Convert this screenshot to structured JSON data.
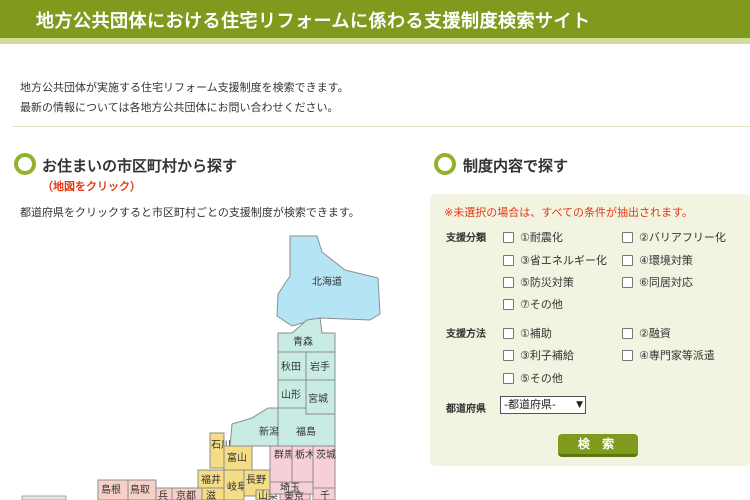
{
  "header": {
    "title": "地方公共団体における住宅リフォームに係わる支援制度検索サイト"
  },
  "intro": {
    "line1": "地方公共団体が実施する住宅リフォーム支援制度を検索できます。",
    "line2": "最新の情報については各地方公共団体にお問い合わせください。"
  },
  "map_section": {
    "title": "お住まいの市区町村から探す",
    "note": "（地図をクリック）",
    "description": "都道府県をクリックすると市区町村ごとの支援制度が検索できます。",
    "prefectures": {
      "hokkaido": "北海道",
      "aomori": "青森",
      "akita": "秋田",
      "iwate": "岩手",
      "yamagata": "山形",
      "miyagi": "宮城",
      "fukushima": "福島",
      "niigata": "新潟",
      "ishikawa": "石川",
      "toyama": "富山",
      "gunma": "群馬",
      "tochigi": "栃木",
      "ibaraki": "茨城",
      "fukui": "福井",
      "nagano": "長野",
      "saitama": "埼玉",
      "gifu": "岐阜",
      "shiga": "滋",
      "yamanashi": "山梨",
      "tokyo": "東京",
      "chiba": "千",
      "shimane": "島根",
      "tottori": "鳥取",
      "hyogo": "兵",
      "kyoto": "京都"
    }
  },
  "criteria_section": {
    "title": "制度内容で探す",
    "note": "※未選択の場合は、すべての条件が抽出されます。",
    "support_type": {
      "label": "支援分類",
      "options": [
        "①耐震化",
        "②バリアフリー化",
        "③省エネルギー化",
        "④環境対策",
        "⑤防災対策",
        "⑥同居対応",
        "⑦その他"
      ]
    },
    "support_method": {
      "label": "支援方法",
      "options": [
        "①補助",
        "②融資",
        "③利子補給",
        "④専門家等派遣",
        "⑤その他"
      ]
    },
    "prefecture": {
      "label": "都道府県",
      "selected": "-都道府県-"
    },
    "search_button": "検 索"
  },
  "colors": {
    "header": "#7f9a1c",
    "tohoku": "#c8ece3",
    "hokkaido": "#b5e4f5",
    "chubu": "#f5dd86",
    "kanto": "#f6cfd8",
    "chugoku": "#f6cfc6",
    "accent_red": "#e23a12"
  }
}
